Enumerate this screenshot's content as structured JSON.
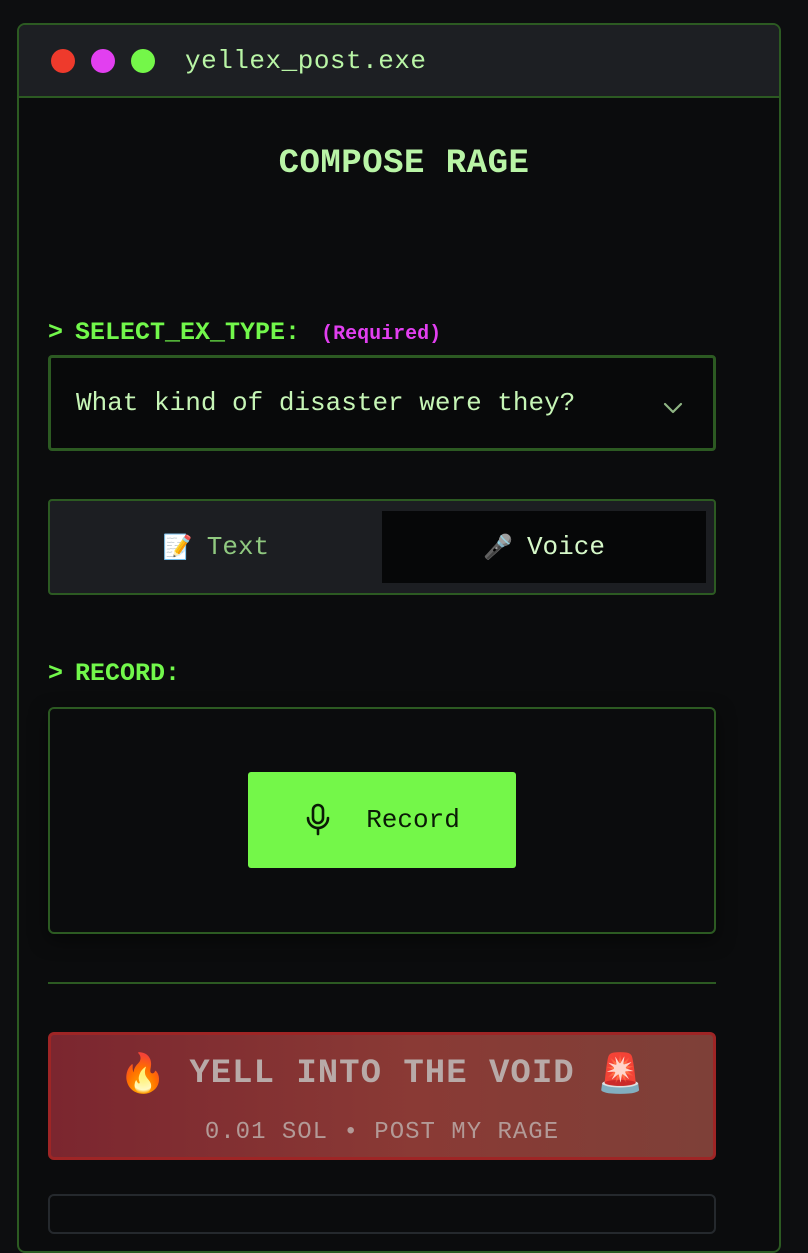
{
  "window": {
    "title": "yellex_post.exe",
    "dot_colors": [
      "#ee3a2c",
      "#e23ff0",
      "#74f749"
    ]
  },
  "page": {
    "heading": "COMPOSE RAGE"
  },
  "ex_type": {
    "prompt": ">",
    "label": "SELECT_EX_TYPE:",
    "required": "(Required)",
    "placeholder": "What kind of disaster were they?",
    "icon": "chevron-down-icon"
  },
  "mode_toggle": {
    "options": [
      {
        "icon": "📝",
        "label": "Text",
        "selected": false
      },
      {
        "icon": "🎤",
        "label": "Voice",
        "selected": true
      }
    ]
  },
  "record": {
    "prompt": ">",
    "label": "RECORD:",
    "button_label": "Record",
    "button_icon": "microphone-icon"
  },
  "submit": {
    "emoji_left": "🔥",
    "label": "YELL INTO THE VOID",
    "emoji_right": "🚨",
    "sub_label": "0.01 SOL • POST MY RAGE"
  },
  "colors": {
    "accent_green": "#74f749",
    "required_magenta": "#e23ff0",
    "border_green": "#2c5a22",
    "submit_red": "#9e2525"
  }
}
